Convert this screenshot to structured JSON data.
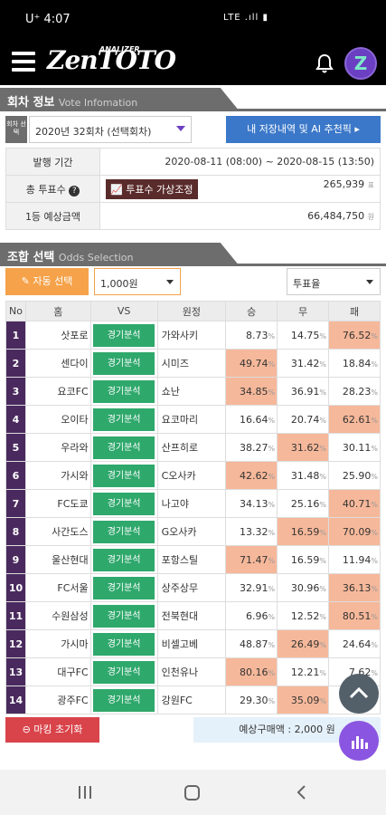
{
  "status": {
    "carrier": "U⁺ 4:07",
    "signal": "LTE .ıll ▮"
  },
  "app": {
    "logo": "ZenTOTO",
    "logo_sub": "ANALIZER"
  },
  "vote_section": {
    "title": "회차 정보",
    "subtitle": "Vote Infomation",
    "round_label": "회차 선택",
    "round_value": "2020년 32회차 (선택회차)",
    "history_button": "내 저장내역 및 AI 추천픽 ▸",
    "rows": [
      {
        "label": "발행 기간",
        "value": "2020-08-11 (08:00) ~ 2020-08-15 (13:50)",
        "unit": ""
      },
      {
        "label": "총 투표수",
        "value": "265,939",
        "unit": "표",
        "adjust": "투표수 가상조정"
      },
      {
        "label": "1등 예상금액",
        "value": "66,484,750",
        "unit": "원"
      }
    ]
  },
  "odds_section": {
    "title": "조합 선택",
    "subtitle": "Odds Selection",
    "auto_button": "자동 선택",
    "amount": "1,000원",
    "sort": "투표율",
    "headers": [
      "No",
      "홈",
      "VS",
      "원정",
      "승",
      "무",
      "패"
    ],
    "analysis_label": "경기분석",
    "matches": [
      {
        "no": "1",
        "home": "삿포로",
        "away": "가와사키",
        "w": "8.73",
        "d": "14.75",
        "l": "76.52",
        "hi": "l"
      },
      {
        "no": "2",
        "home": "센다이",
        "away": "시미즈",
        "w": "49.74",
        "d": "31.42",
        "l": "18.84",
        "hi": "w"
      },
      {
        "no": "3",
        "home": "요코FC",
        "away": "쇼난",
        "w": "34.85",
        "d": "36.91",
        "l": "28.23",
        "hi": "w"
      },
      {
        "no": "4",
        "home": "오이타",
        "away": "요코마리",
        "w": "16.64",
        "d": "20.74",
        "l": "62.61",
        "hi": "l"
      },
      {
        "no": "5",
        "home": "우라와",
        "away": "산프히로",
        "w": "38.27",
        "d": "31.62",
        "l": "30.11",
        "hi": "d"
      },
      {
        "no": "6",
        "home": "가시와",
        "away": "C오사카",
        "w": "42.62",
        "d": "31.48",
        "l": "25.90",
        "hi": "w"
      },
      {
        "no": "7",
        "home": "FC도쿄",
        "away": "나고야",
        "w": "34.13",
        "d": "25.16",
        "l": "40.71",
        "hi": "l"
      },
      {
        "no": "8",
        "home": "사간도스",
        "away": "G오사카",
        "w": "13.32",
        "d": "16.59",
        "l": "70.09",
        "hi": "dl"
      },
      {
        "no": "9",
        "home": "울산현대",
        "away": "포항스틸",
        "w": "71.47",
        "d": "16.59",
        "l": "11.94",
        "hi": "w"
      },
      {
        "no": "10",
        "home": "FC서울",
        "away": "상주상무",
        "w": "32.91",
        "d": "30.96",
        "l": "36.13",
        "hi": "l"
      },
      {
        "no": "11",
        "home": "수원삼성",
        "away": "전북현대",
        "w": "6.96",
        "d": "12.52",
        "l": "80.51",
        "hi": "l"
      },
      {
        "no": "12",
        "home": "가시마",
        "away": "비셀고베",
        "w": "48.87",
        "d": "26.49",
        "l": "24.64",
        "hi": "d"
      },
      {
        "no": "13",
        "home": "대구FC",
        "away": "인천유나",
        "w": "80.16",
        "d": "12.21",
        "l": "7.62",
        "hi": "w"
      },
      {
        "no": "14",
        "home": "광주FC",
        "away": "강원FC",
        "w": "29.30",
        "d": "35.09",
        "l": "",
        "hi": "d"
      }
    ],
    "reset_button": "마킹 초기화",
    "expected_label": "예상구매액 : 2,000 원"
  }
}
